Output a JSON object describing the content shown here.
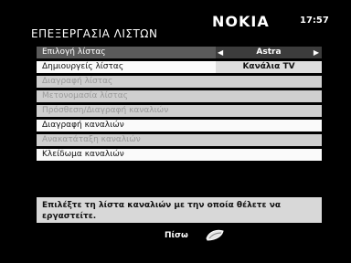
{
  "header": {
    "title": "ΕΠΕΞΕΡΓΑΣΙΑ ΛΙΣΤΩΝ",
    "brand": "NOKIA",
    "clock": "17:57"
  },
  "menu": {
    "items": [
      {
        "label": "Επιλογή λίστας",
        "value": "Astra",
        "state": "selected"
      },
      {
        "label": "Δημιουργείς λίστας",
        "value": "Κανάλια TV",
        "state": "enabled"
      },
      {
        "label": "Διαγραφή λίστας",
        "state": "disabled"
      },
      {
        "label": "Μετονομασία λίστας",
        "state": "disabled"
      },
      {
        "label": "Πρόσθεση/Διαγραφή καναλιών",
        "state": "disabled"
      },
      {
        "label": "Διαγραφή καναλιών",
        "state": "enabled"
      },
      {
        "label": "Ανακατάταξη καναλιών",
        "state": "disabled"
      },
      {
        "label": "Κλείδωμα καναλιών",
        "state": "enabled"
      }
    ]
  },
  "info": {
    "text": "Επιλέξτε τη λίστα καναλιών με την οποία θέλετε να εργαστείτε."
  },
  "footer": {
    "back_label": "Πίσω",
    "back_icon": "remote-key-icon"
  },
  "icons": {
    "left": "arrow-left-icon",
    "right": "arrow-right-icon"
  },
  "colors": {
    "background": "#000000",
    "row": "#fafafa",
    "row_selected": "#5a5a5a",
    "row_disabled": "#cfcfcf",
    "info_bg": "#d8d8d8"
  }
}
